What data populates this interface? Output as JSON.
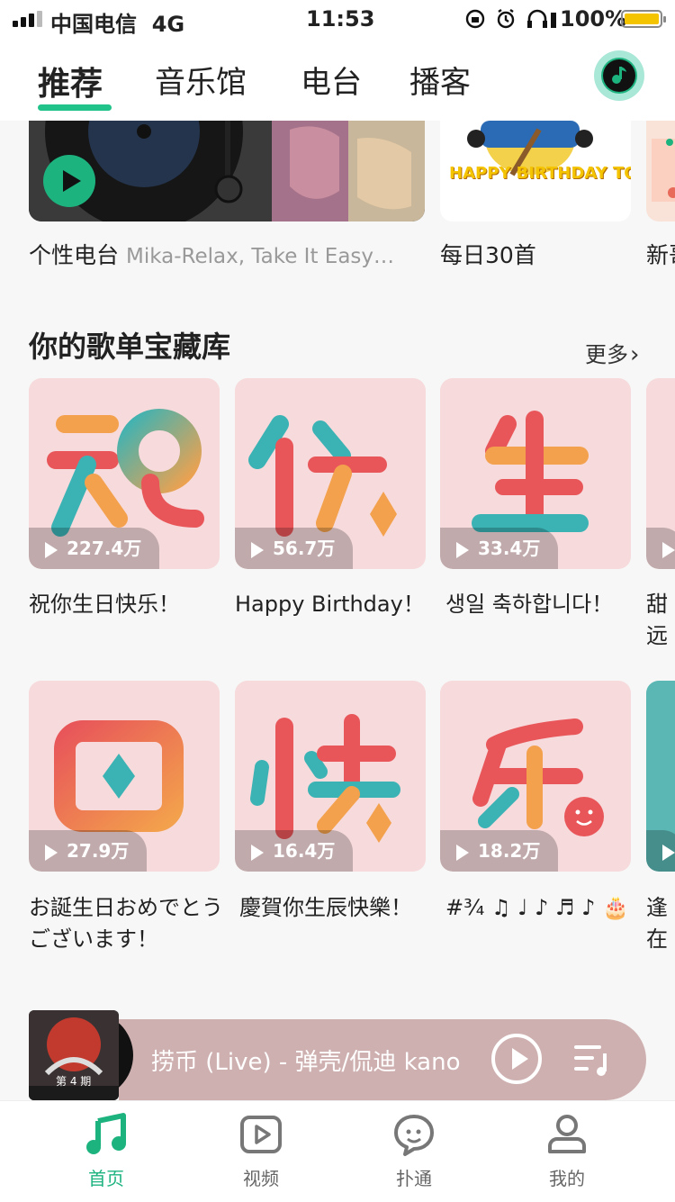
{
  "status_bar": {
    "carrier": "中国电信",
    "network": "4G",
    "time": "11:53",
    "battery": "100%",
    "battery_color": "#f5c400"
  },
  "top_nav": {
    "tabs": [
      {
        "label": "推荐",
        "active": true
      },
      {
        "label": "音乐馆",
        "active": false
      },
      {
        "label": "电台",
        "active": false
      },
      {
        "label": "播客",
        "active": false
      }
    ],
    "accent": "#22c28b",
    "music_icon": "music-note-icon"
  },
  "radio_row": [
    {
      "title": "个性电台",
      "subtitle": "Mika-Relax, Take It Easy…"
    },
    {
      "title": "每日30首",
      "cover_text": "HAPPY BIRTHDAY TO YOU"
    },
    {
      "title": "新哥"
    }
  ],
  "playlist_section": {
    "title": "你的歌单宝藏库",
    "more": "更多"
  },
  "playlists": [
    {
      "glyph": "祝",
      "plays": "227.4万",
      "title": "祝你生日快乐！"
    },
    {
      "glyph": "你",
      "plays": "56.7万",
      "title": "Happy Birthday！"
    },
    {
      "glyph": "生",
      "plays": "33.4万",
      "title": "생일 축하합니다！"
    },
    {
      "glyph": "日",
      "plays": "27.9万",
      "title": "お誕生日おめでとうございます！"
    },
    {
      "glyph": "快",
      "plays": "16.4万",
      "title": "慶賀你生辰快樂！"
    },
    {
      "glyph": "乐",
      "plays": "18.2万",
      "title": "#³⁄₄ ♫ ♩ ♪ ♬ ♪ 🎂"
    }
  ],
  "partial_cards": {
    "row1_title": "甜",
    "row1_title2": "远",
    "row2_title": "逢",
    "row2_title2": "在"
  },
  "mini_player": {
    "title": "捞币 (Live) - 弹壳/侃迪 kano",
    "cover_text": "第 4 期"
  },
  "bottom_nav": [
    {
      "label": "首页",
      "icon": "music-note-icon",
      "active": true
    },
    {
      "label": "视频",
      "icon": "video-play-icon",
      "active": false
    },
    {
      "label": "扑通",
      "icon": "chat-bubble-icon",
      "active": false
    },
    {
      "label": "我的",
      "icon": "user-icon",
      "active": false
    }
  ],
  "colors": {
    "brand_green": "#1db37f",
    "card_bg": "#f7dadb",
    "player_bg": "#cfb0b0"
  }
}
